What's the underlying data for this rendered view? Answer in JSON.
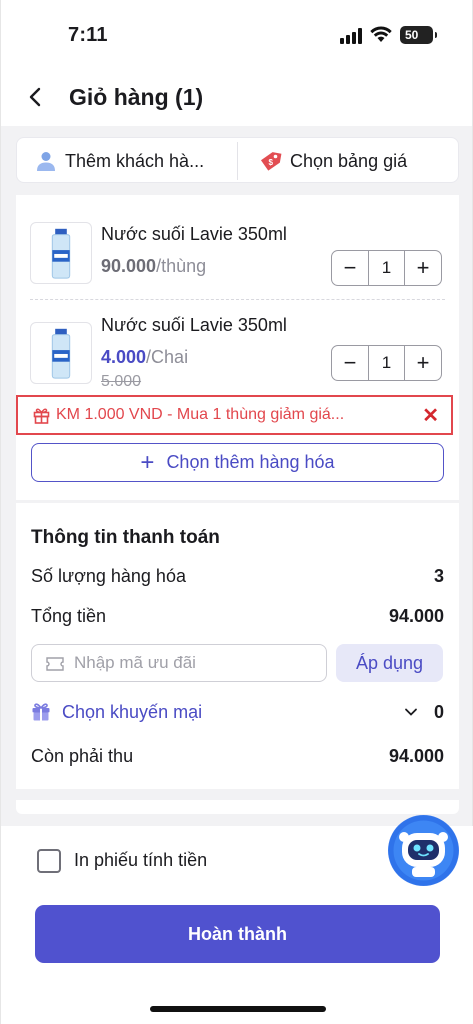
{
  "status_bar": {
    "time": "7:11",
    "battery": "50"
  },
  "header": {
    "title": "Giỏ hàng (1)"
  },
  "selectors": {
    "customer": "Thêm khách hà...",
    "price_list": "Chọn bảng giá"
  },
  "cart": {
    "items": [
      {
        "name": "Nước suối Lavie 350ml",
        "price": "90.000",
        "unit": "/thùng",
        "qty": "1",
        "old_price": ""
      },
      {
        "name": "Nước suối Lavie 350ml",
        "price": "4.000",
        "unit": "/Chai",
        "qty": "1",
        "old_price": "5.000"
      }
    ],
    "promo_text": "KM 1.000 VND - Mua 1 thùng giảm giá...",
    "add_more": "Chọn thêm hàng hóa"
  },
  "payment": {
    "title": "Thông tin thanh toán",
    "qty_label": "Số lượng hàng hóa",
    "qty_value": "3",
    "total_label": "Tổng tiền",
    "total_value": "94.000",
    "code_placeholder": "Nhập mã ưu đãi",
    "apply_label": "Áp dụng",
    "promo_label": "Chọn khuyến mại",
    "promo_count": "0",
    "due_label": "Còn phải thu",
    "due_value": "94.000"
  },
  "footer": {
    "print_label": "In phiếu tính tiền",
    "complete_label": "Hoàn thành"
  },
  "colors": {
    "accent": "#5052cf",
    "promo_red": "#e2474d",
    "price_blue": "#4a4bc4"
  }
}
